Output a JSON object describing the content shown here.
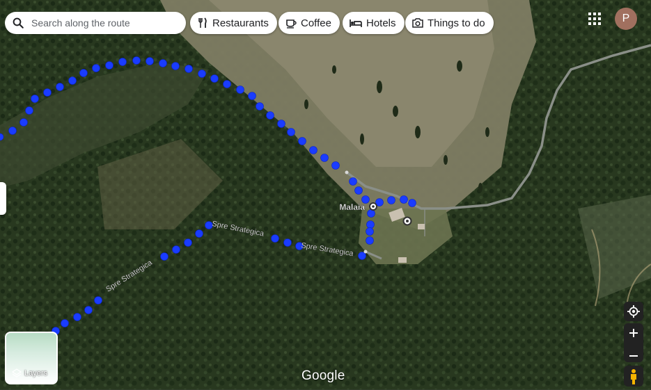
{
  "search": {
    "placeholder": "Search along the route",
    "icon": "search-icon"
  },
  "chips": [
    {
      "label": "Restaurants",
      "icon": "fork-knife-icon"
    },
    {
      "label": "Coffee",
      "icon": "coffee-cup-icon"
    },
    {
      "label": "Hotels",
      "icon": "bed-icon"
    },
    {
      "label": "Things to do",
      "icon": "camera-icon"
    }
  ],
  "account": {
    "initial": "P",
    "color": "#a1705f"
  },
  "map": {
    "place_label": "Malaia",
    "road_labels": [
      "Spre Strategica",
      "Spre Strategica"
    ],
    "route_color": "#1a3cff",
    "road_color": "#8a8f88"
  },
  "layers": {
    "label": "Layers"
  },
  "attribution": "Google"
}
